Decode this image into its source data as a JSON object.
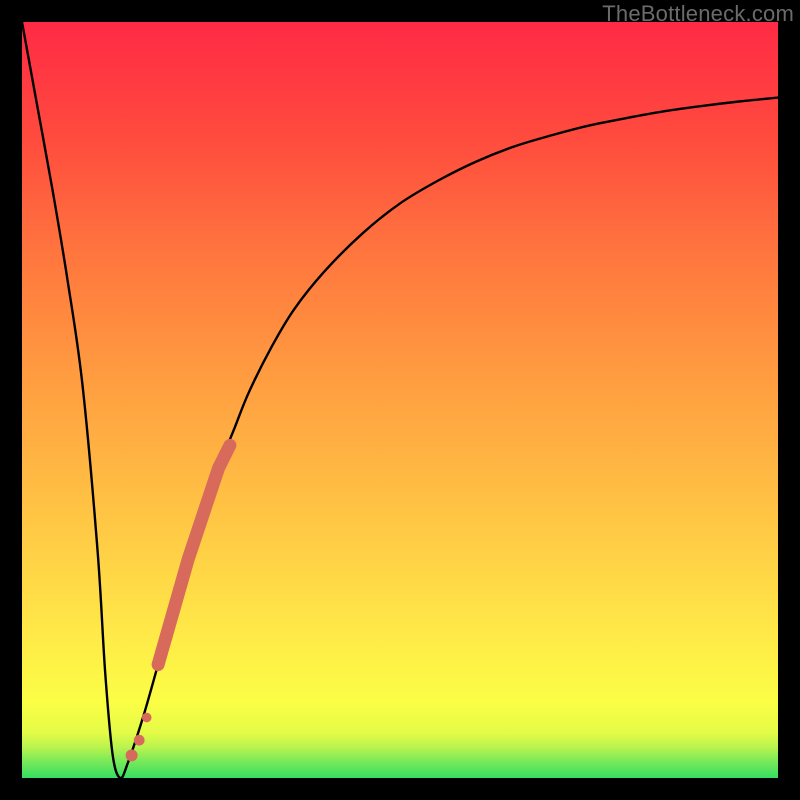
{
  "watermark": "TheBottleneck.com",
  "chart_data": {
    "type": "line",
    "title": "",
    "xlabel": "",
    "ylabel": "",
    "xlim": [
      0,
      100
    ],
    "ylim": [
      0,
      100
    ],
    "grid": false,
    "legend": false,
    "note": "Values estimated from pixel positions; no axes or tick labels shown. Y interpreted as bottleneck percentage (0 = optimal, at valley). Gradient background encodes Y: green near 0, through yellow/orange to red near 100. Accent dotted segment overlays the rising branch of the curve.",
    "background_gradient_stops": [
      {
        "y": 0,
        "color": "#36de62"
      },
      {
        "y": 2,
        "color": "#72e85a"
      },
      {
        "y": 4,
        "color": "#b7f34e"
      },
      {
        "y": 6,
        "color": "#e4fb47"
      },
      {
        "y": 10,
        "color": "#fbfe45"
      },
      {
        "y": 20,
        "color": "#ffe748"
      },
      {
        "y": 40,
        "color": "#ffb943"
      },
      {
        "y": 55,
        "color": "#ff9840"
      },
      {
        "y": 70,
        "color": "#ff743e"
      },
      {
        "y": 85,
        "color": "#ff4a3e"
      },
      {
        "y": 100,
        "color": "#ff2a45"
      }
    ],
    "series": [
      {
        "name": "bottleneck_curve",
        "stroke": "#000000",
        "x": [
          0,
          2,
          4,
          6,
          8,
          10,
          11,
          12,
          13,
          14,
          16,
          18,
          20,
          22,
          24,
          26,
          28,
          30,
          33,
          36,
          40,
          45,
          50,
          55,
          60,
          65,
          70,
          75,
          80,
          85,
          90,
          95,
          100
        ],
        "y": [
          100,
          89,
          78,
          66,
          52,
          30,
          14,
          3,
          0,
          2,
          8,
          15,
          22,
          29,
          35,
          41,
          46,
          51,
          57,
          62,
          67,
          72,
          76,
          79,
          81.5,
          83.5,
          85,
          86.3,
          87.3,
          88.2,
          88.9,
          89.5,
          90
        ]
      },
      {
        "name": "accent_overlay",
        "stroke": "#d86a5c",
        "style": "dotted-thick",
        "x": [
          14.5,
          15.5,
          16.5,
          18.0,
          20.0,
          22.0,
          24.0,
          26.0,
          27.5
        ],
        "y": [
          3.0,
          5.0,
          8.0,
          15.0,
          22.0,
          29.0,
          35.0,
          41.0,
          44.0
        ]
      }
    ]
  }
}
